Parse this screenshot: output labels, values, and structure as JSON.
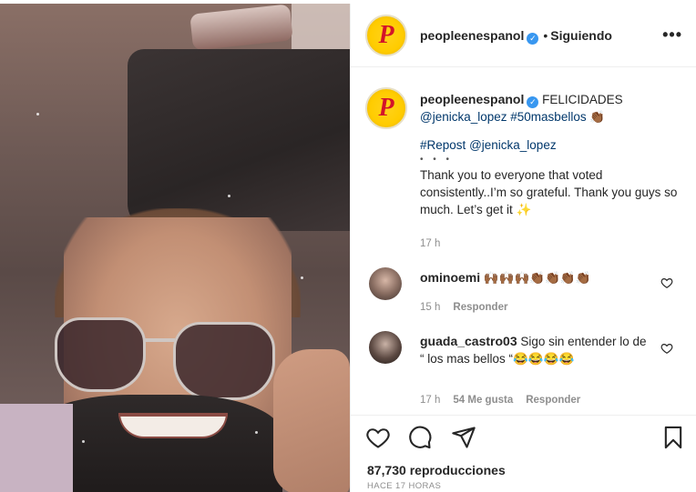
{
  "post": {
    "username": "peopleenespanol",
    "verified_mark": "✓",
    "separator": "•",
    "follow_status": "Siguiendo",
    "more_menu": "•••",
    "avatar_letter": "P"
  },
  "caption": {
    "username": "peopleenespanol",
    "line1_text": "FELICIDADES",
    "line2_tag1": "@jenicka_lopez",
    "line2_tag2": "#50masbellos",
    "line2_emoji": "👏🏾",
    "repost_tag": "#Repost",
    "repost_user": "@jenicka_lopez",
    "dots": "• • •",
    "body": "Thank you to everyone that voted consistently..I’m so grateful. Thank you guys so much. Let’s get it",
    "body_emoji": "✨",
    "time": "17 h"
  },
  "comments": [
    {
      "username": "ominoemi",
      "text": "🙌🏾🙌🏾🙌🏾👏🏾👏🏾👏🏾👏🏾",
      "time": "15 h",
      "likes": "",
      "reply": "Responder"
    },
    {
      "username": "guada_castro03",
      "text": "Sigo sin entender lo de “ los mas bellos “😂😂😂😂",
      "time": "17 h",
      "likes": "54 Me gusta",
      "reply": "Responder"
    }
  ],
  "actions": {
    "icons": [
      "heart-icon",
      "comment-icon",
      "share-icon",
      "bookmark-icon"
    ],
    "views": "87,730 reproducciones",
    "posted_ago": "HACE 17 HORAS"
  },
  "colors": {
    "text": "#262626",
    "muted": "#8e8e8e",
    "link": "#00376b",
    "verified": "#3897f0",
    "avatar_yellow": "#ffcc00",
    "avatar_red": "#d3132a"
  }
}
